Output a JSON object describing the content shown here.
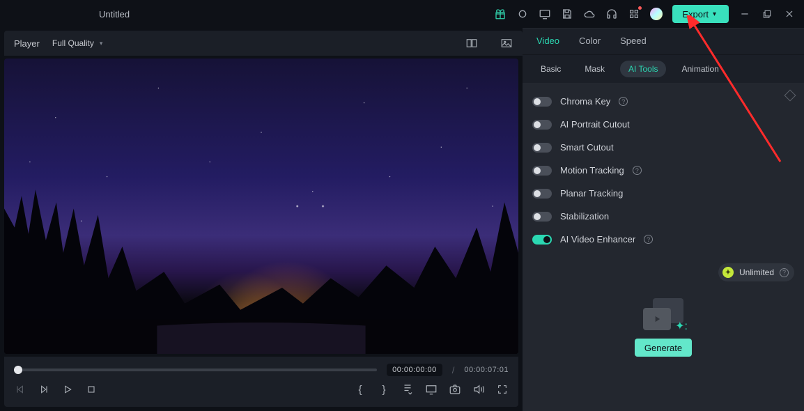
{
  "titlebar": {
    "title": "Untitled",
    "export": "Export"
  },
  "player_header": {
    "label": "Player",
    "quality": "Full Quality"
  },
  "transport": {
    "current": "00:00:00:00",
    "separator": "/",
    "duration": "00:00:07:01"
  },
  "right_panel": {
    "tabs1": [
      "Video",
      "Color",
      "Speed"
    ],
    "tabs1_active": 0,
    "tabs2": [
      "Basic",
      "Mask",
      "AI Tools",
      "Animation"
    ],
    "tabs2_active": 2,
    "toggles": [
      {
        "label": "Chroma Key",
        "on": false,
        "help": true
      },
      {
        "label": "AI Portrait Cutout",
        "on": false,
        "help": false
      },
      {
        "label": "Smart Cutout",
        "on": false,
        "help": false
      },
      {
        "label": "Motion Tracking",
        "on": false,
        "help": true
      },
      {
        "label": "Planar Tracking",
        "on": false,
        "help": false
      },
      {
        "label": "Stabilization",
        "on": false,
        "help": false
      },
      {
        "label": "AI Video Enhancer",
        "on": true,
        "help": true
      }
    ],
    "unlimited": "Unlimited",
    "generate": "Generate"
  }
}
